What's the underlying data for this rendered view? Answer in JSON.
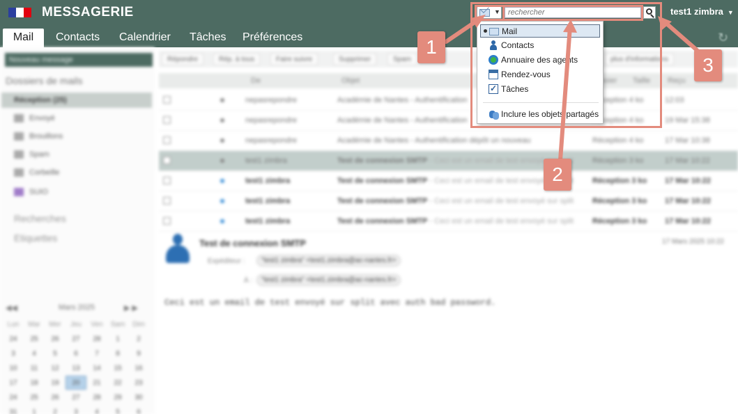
{
  "header": {
    "app_title": "MESSAGERIE",
    "user_name": "test1 zimbra",
    "colors": {
      "bar": "#4d6b62",
      "annotation": "#e38b7d"
    }
  },
  "tabs": [
    {
      "label": "Mail",
      "active": true
    },
    {
      "label": "Contacts"
    },
    {
      "label": "Calendrier"
    },
    {
      "label": "Tâches"
    },
    {
      "label": "Préférences"
    }
  ],
  "search": {
    "placeholder": "rechercher",
    "type_icon": "mail-envelope-icon"
  },
  "search_menu": {
    "items": [
      {
        "label": "Mail",
        "icon": "mail-icon",
        "checked": true
      },
      {
        "label": "Contacts",
        "icon": "contact-icon"
      },
      {
        "label": "Annuaire des agents",
        "icon": "directory-icon"
      },
      {
        "label": "Rendez-vous",
        "icon": "calendar-icon"
      },
      {
        "label": "Tâches",
        "icon": "task-checkbox-icon"
      }
    ],
    "shared_label": "Inclure les objets partagés"
  },
  "annotations": {
    "one": "1",
    "two": "2",
    "three": "3"
  },
  "sidebar": {
    "new_message": "Nouveau message",
    "folders_header": "Dossiers de mails",
    "folders": [
      "Réception (25)",
      "Envoyé",
      "Brouillons",
      "Spam",
      "Corbeille",
      "SUIO"
    ],
    "searches": "Recherches",
    "tags": "Etiquettes"
  },
  "calendar": {
    "month": "Mars 2025",
    "weekdays": [
      "Lun",
      "Mar",
      "Mer",
      "Jeu",
      "Ven",
      "Sam",
      "Dim"
    ],
    "days": [
      "24",
      "25",
      "26",
      "27",
      "28",
      "1",
      "2",
      "3",
      "4",
      "5",
      "6",
      "7",
      "8",
      "9",
      "10",
      "11",
      "12",
      "13",
      "14",
      "15",
      "16",
      "17",
      "18",
      "19",
      "20",
      "21",
      "22",
      "23",
      "24",
      "25",
      "26",
      "27",
      "28",
      "29",
      "30",
      "31",
      "1",
      "2",
      "3",
      "4",
      "5",
      "6"
    ],
    "today": "20"
  },
  "toolbar": {
    "buttons": [
      "Répondre",
      "Rép. à tous",
      "Faire suivre",
      "Supprimer",
      "Spam"
    ],
    "extra": "plus d'informations"
  },
  "list": {
    "headers": {
      "from": "De",
      "subject": "Objet",
      "folder": "Dossier",
      "size": "Taille",
      "received": "Reçu"
    },
    "rows": [
      {
        "from": "nepasrepondre",
        "subject": "Académie de Nantes - Authentification",
        "fragment": "",
        "folder": "Réception 4 ko",
        "date": "12:03",
        "unread": false
      },
      {
        "from": "nepasrepondre",
        "subject": "Académie de Nantes - Authentification",
        "fragment": "",
        "folder": "Réception 4 ko",
        "date": "19 Mar 15:38",
        "unread": false
      },
      {
        "from": "nepasrepondre",
        "subject": "Académie de Nantes - Authentification dépôt un nouveau",
        "fragment": "",
        "folder": "Réception 4 ko",
        "date": "17 Mar 10:38",
        "unread": false
      },
      {
        "from": "test1 zimbra",
        "subject": "Test de connexion SMTP",
        "fragment": " - Ceci est un email de test envoyé sur split",
        "folder": "Réception 3 ko",
        "date": "17 Mar 10:22",
        "unread": false,
        "selected": true
      },
      {
        "from": "test1 zimbra",
        "subject": "Test de connexion SMTP",
        "fragment": " - Ceci est un email de test envoyé sur split",
        "folder": "Réception 3 ko",
        "date": "17 Mar 10:22",
        "unread": true
      },
      {
        "from": "test1 zimbra",
        "subject": "Test de connexion SMTP",
        "fragment": " - Ceci est un email de test envoyé sur split",
        "folder": "Réception 3 ko",
        "date": "17 Mar 10:22",
        "unread": true
      },
      {
        "from": "test1 zimbra",
        "subject": "Test de connexion SMTP",
        "fragment": " - Ceci est un email de test envoyé sur split",
        "folder": "Réception 3 ko",
        "date": "17 Mar 10:22",
        "unread": true
      }
    ]
  },
  "reading": {
    "subject": "Test de connexion SMTP",
    "date": "17 Mars 2025 10:22",
    "from_label": "Expéditeur :",
    "from": "\"test1 zimbra\" <test1.zimbra@ac-nantes.fr>",
    "to_label": "À :",
    "to": "\"test1 zimbra\" <test1.zimbra@ac-nantes.fr>",
    "body": "Ceci est un email de test envoyé sur split avec auth bad password."
  }
}
